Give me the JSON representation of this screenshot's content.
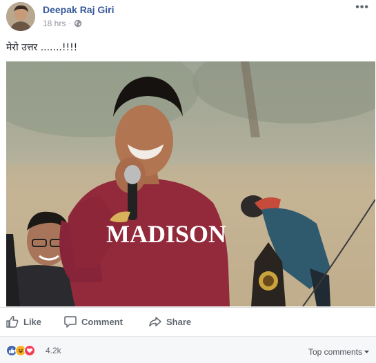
{
  "post": {
    "author": "Deepak Raj Giri",
    "time": "18 hrs",
    "separator": "·",
    "privacy_icon": "globe-icon",
    "more_label": "•••",
    "text": "मेरो उत्तर .......!!!!",
    "photo_shirt_text": "MADISON"
  },
  "actions": {
    "like": "Like",
    "comment": "Comment",
    "share": "Share"
  },
  "reactions": {
    "types": [
      "like",
      "haha",
      "love"
    ],
    "count": "4.2k",
    "sort_label": "Top comments"
  },
  "colors": {
    "link": "#365899",
    "muted": "#90949c",
    "like": "#4267b2",
    "haha": "#f7b125",
    "love": "#f33e58"
  }
}
